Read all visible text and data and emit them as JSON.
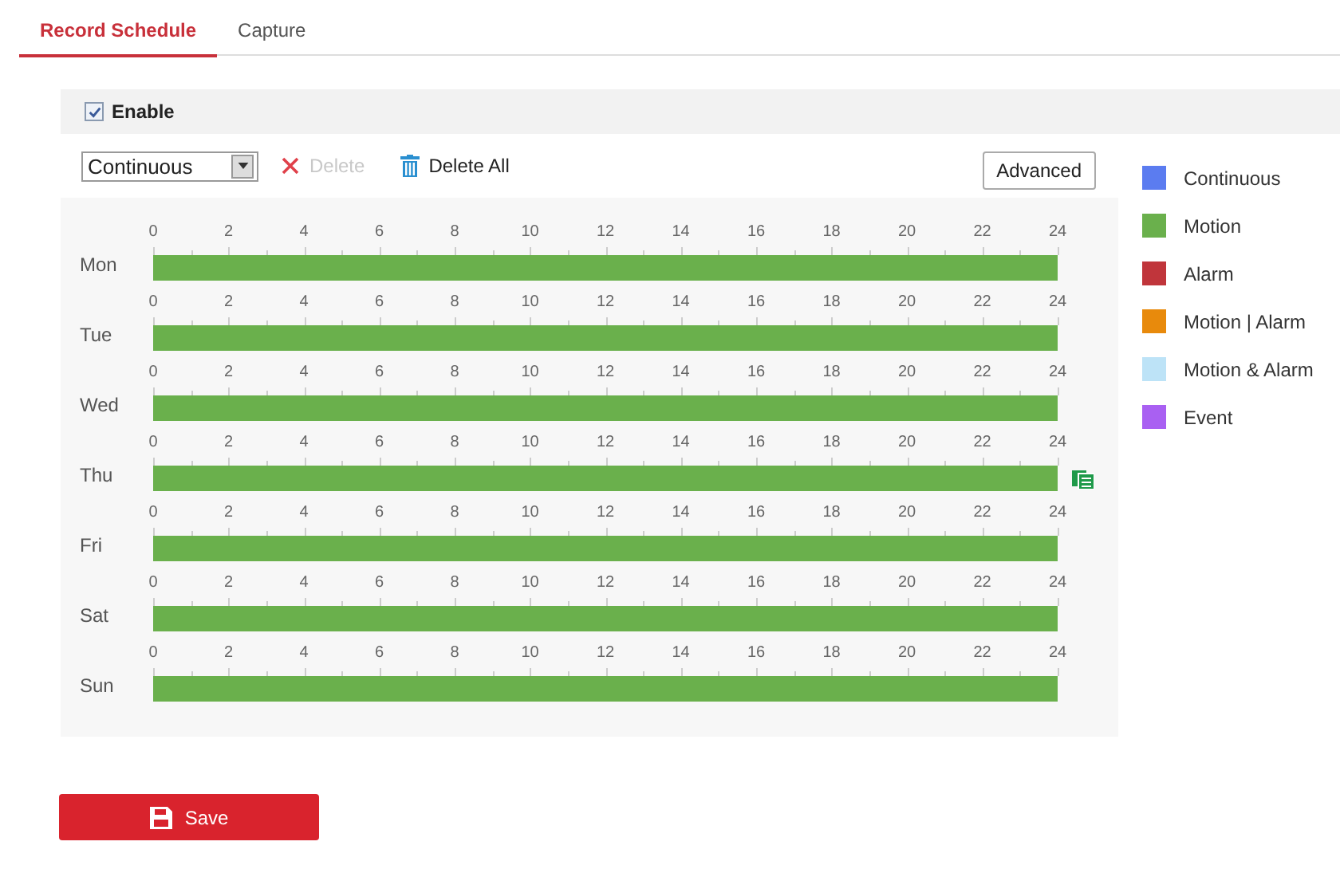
{
  "tabs": [
    {
      "label": "Record Schedule",
      "selected": true
    },
    {
      "label": "Capture",
      "selected": false
    }
  ],
  "enable": {
    "label": "Enable",
    "checked": true
  },
  "toolbar": {
    "type_select": {
      "value": "Continuous"
    },
    "delete": {
      "label": "Delete",
      "disabled": true
    },
    "delete_all": {
      "label": "Delete All",
      "disabled": false
    },
    "advanced": {
      "label": "Advanced"
    }
  },
  "schedule": [
    {
      "day": "Mon",
      "kind": "motion",
      "copy_shown": false,
      "hours": [
        "0",
        "2",
        "4",
        "6",
        "8",
        "10",
        "12",
        "14",
        "16",
        "18",
        "20",
        "22",
        "24"
      ]
    },
    {
      "day": "Tue",
      "kind": "motion",
      "copy_shown": false,
      "hours": [
        "0",
        "2",
        "4",
        "6",
        "8",
        "10",
        "12",
        "14",
        "16",
        "18",
        "20",
        "22",
        "24"
      ]
    },
    {
      "day": "Wed",
      "kind": "motion",
      "copy_shown": false,
      "hours": [
        "0",
        "2",
        "4",
        "6",
        "8",
        "10",
        "12",
        "14",
        "16",
        "18",
        "20",
        "22",
        "24"
      ]
    },
    {
      "day": "Thu",
      "kind": "motion",
      "copy_shown": true,
      "hours": [
        "0",
        "2",
        "4",
        "6",
        "8",
        "10",
        "12",
        "14",
        "16",
        "18",
        "20",
        "22",
        "24"
      ]
    },
    {
      "day": "Fri",
      "kind": "motion",
      "copy_shown": false,
      "hours": [
        "0",
        "2",
        "4",
        "6",
        "8",
        "10",
        "12",
        "14",
        "16",
        "18",
        "20",
        "22",
        "24"
      ]
    },
    {
      "day": "Sat",
      "kind": "motion",
      "copy_shown": false,
      "hours": [
        "0",
        "2",
        "4",
        "6",
        "8",
        "10",
        "12",
        "14",
        "16",
        "18",
        "20",
        "22",
        "24"
      ]
    },
    {
      "day": "Sun",
      "kind": "motion",
      "copy_shown": false,
      "hours": [
        "0",
        "2",
        "4",
        "6",
        "8",
        "10",
        "12",
        "14",
        "16",
        "18",
        "20",
        "22",
        "24"
      ]
    }
  ],
  "legend": [
    {
      "label": "Continuous",
      "kind": "continuous",
      "color": "#5b7cf0"
    },
    {
      "label": "Motion",
      "kind": "motion",
      "color": "#6ab04c"
    },
    {
      "label": "Alarm",
      "kind": "alarm",
      "color": "#c0353b"
    },
    {
      "label": "Motion | Alarm",
      "kind": "motion_or_alarm",
      "color": "#e88a0c"
    },
    {
      "label": "Motion & Alarm",
      "kind": "motion_and_alarm",
      "color": "#bde3f7"
    },
    {
      "label": "Event",
      "kind": "event",
      "color": "#a960f2"
    }
  ],
  "save": {
    "label": "Save"
  }
}
